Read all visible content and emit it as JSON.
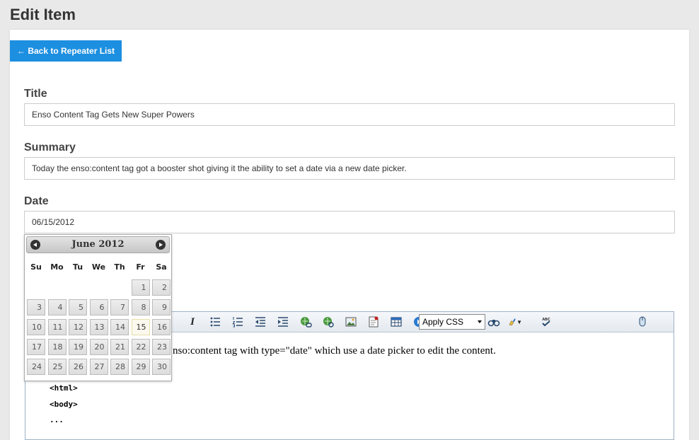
{
  "page": {
    "title": "Edit Item"
  },
  "back_button": {
    "label": "← Back to Repeater List"
  },
  "form": {
    "title": {
      "label": "Title",
      "value": "Enso Content Tag Gets New Super Powers"
    },
    "summary": {
      "label": "Summary",
      "value": "Today the enso:content tag got a booster shot giving it the ability to set a date via a new date picker."
    },
    "date": {
      "label": "Date",
      "value": "06/15/2012"
    }
  },
  "datepicker": {
    "month_label": "June 2012",
    "weekdays": [
      "Su",
      "Mo",
      "Tu",
      "We",
      "Th",
      "Fr",
      "Sa"
    ],
    "weeks": [
      [
        "",
        "",
        "",
        "",
        "",
        "1",
        "2"
      ],
      [
        "3",
        "4",
        "5",
        "6",
        "7",
        "8",
        "9"
      ],
      [
        "10",
        "11",
        "12",
        "13",
        "14",
        "15",
        "16"
      ],
      [
        "17",
        "18",
        "19",
        "20",
        "21",
        "22",
        "23"
      ],
      [
        "24",
        "25",
        "26",
        "27",
        "28",
        "29",
        "30"
      ]
    ],
    "highlighted_day": "15"
  },
  "editor": {
    "css_select_value": "Apply CSS",
    "body_text": "nso:content tag with type=\"date\" which use a date picker to edit the content.",
    "code_lines": [
      "<html>",
      "<body>",
      "..."
    ]
  },
  "colors": {
    "accent": "#1d8fe0"
  },
  "toolbar_icons": [
    "italic-icon",
    "bullet-list-icon",
    "numbered-list-icon",
    "outdent-icon",
    "indent-icon",
    "insert-link-icon",
    "remove-link-icon",
    "insert-image-icon",
    "insert-document-icon",
    "insert-table-icon",
    "insert-media-icon",
    "html-snippet-icon",
    "special-character-icon",
    "find-replace-icon",
    "format-stripper-icon",
    "spellcheck-icon",
    "apply-css-select",
    "mouse-icon"
  ]
}
